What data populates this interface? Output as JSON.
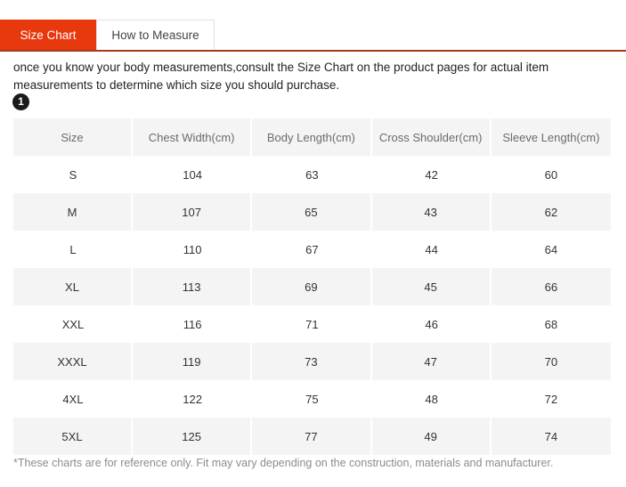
{
  "tabs": [
    {
      "label": "Size Chart",
      "active": true
    },
    {
      "label": "How to Measure",
      "active": false
    }
  ],
  "intro": {
    "text": "once you know your body measurements,consult the Size Chart on the product pages for actual item measurements to determine which size you should purchase."
  },
  "step_badge": {
    "label": "1"
  },
  "table": {
    "headers": [
      "Size",
      "Chest Width(cm)",
      "Body Length(cm)",
      "Cross Shoulder(cm)",
      "Sleeve Length(cm)"
    ],
    "rows": [
      [
        "S",
        "104",
        "63",
        "42",
        "60"
      ],
      [
        "M",
        "107",
        "65",
        "43",
        "62"
      ],
      [
        "L",
        "110",
        "67",
        "44",
        "64"
      ],
      [
        "XL",
        "113",
        "69",
        "45",
        "66"
      ],
      [
        "XXL",
        "116",
        "71",
        "46",
        "68"
      ],
      [
        "XXXL",
        "119",
        "73",
        "47",
        "70"
      ],
      [
        "4XL",
        "122",
        "75",
        "48",
        "72"
      ],
      [
        "5XL",
        "125",
        "77",
        "49",
        "74"
      ]
    ]
  },
  "footnote": {
    "text": "*These charts are for reference only. Fit may vary depending on the construction, materials and manufacturer."
  },
  "colors": {
    "active_tab_bg": "#E8380D",
    "tab_underline": "#A33A1E",
    "row_stripe": "#f4f4f4",
    "header_text": "#6b6b6b",
    "badge_bg": "#1a1a1a"
  }
}
